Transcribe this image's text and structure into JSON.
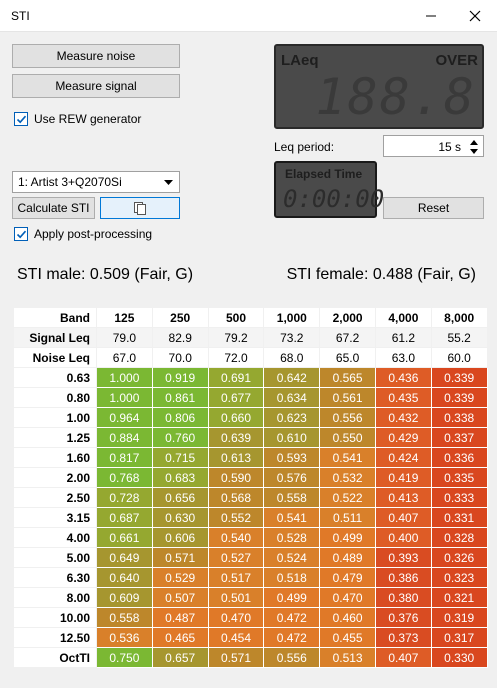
{
  "window": {
    "title": "STI"
  },
  "buttons": {
    "measure_noise": "Measure noise",
    "measure_signal": "Measure signal",
    "calculate_sti": "Calculate STI",
    "reset": "Reset"
  },
  "checkboxes": {
    "use_rew_generator": {
      "label": "Use REW generator",
      "checked": true
    },
    "apply_post_processing": {
      "label": "Apply post-processing",
      "checked": true
    }
  },
  "device_select": {
    "value": "1: Artist 3+Q2070Si"
  },
  "meter": {
    "label": "LAeq",
    "over": "OVER",
    "digits": "188.8"
  },
  "leq_period": {
    "label": "Leq period:",
    "value": "15 s"
  },
  "elapsed": {
    "label": "Elapsed Time",
    "value": "0:00:00"
  },
  "results": {
    "male": "STI male: 0.509 (Fair, G)",
    "female": "STI female: 0.488 (Fair, G)"
  },
  "table": {
    "bands": [
      "125",
      "250",
      "500",
      "1,000",
      "2,000",
      "4,000",
      "8,000"
    ],
    "header_label": "Band",
    "signal_label": "Signal Leq",
    "signal": [
      "79.0",
      "82.9",
      "79.2",
      "73.2",
      "67.2",
      "61.2",
      "55.2"
    ],
    "noise_label": "Noise Leq",
    "noise": [
      "67.0",
      "70.0",
      "72.0",
      "68.0",
      "65.0",
      "63.0",
      "60.0"
    ],
    "rows": [
      {
        "label": "0.63",
        "values": [
          "1.000",
          "0.919",
          "0.691",
          "0.642",
          "0.565",
          "0.436",
          "0.339"
        ]
      },
      {
        "label": "0.80",
        "values": [
          "1.000",
          "0.861",
          "0.677",
          "0.634",
          "0.561",
          "0.435",
          "0.339"
        ]
      },
      {
        "label": "1.00",
        "values": [
          "0.964",
          "0.806",
          "0.660",
          "0.623",
          "0.556",
          "0.432",
          "0.338"
        ]
      },
      {
        "label": "1.25",
        "values": [
          "0.884",
          "0.760",
          "0.639",
          "0.610",
          "0.550",
          "0.429",
          "0.337"
        ]
      },
      {
        "label": "1.60",
        "values": [
          "0.817",
          "0.715",
          "0.613",
          "0.593",
          "0.541",
          "0.424",
          "0.336"
        ]
      },
      {
        "label": "2.00",
        "values": [
          "0.768",
          "0.683",
          "0.590",
          "0.576",
          "0.532",
          "0.419",
          "0.335"
        ]
      },
      {
        "label": "2.50",
        "values": [
          "0.728",
          "0.656",
          "0.568",
          "0.558",
          "0.522",
          "0.413",
          "0.333"
        ]
      },
      {
        "label": "3.15",
        "values": [
          "0.687",
          "0.630",
          "0.552",
          "0.541",
          "0.511",
          "0.407",
          "0.331"
        ]
      },
      {
        "label": "4.00",
        "values": [
          "0.661",
          "0.606",
          "0.540",
          "0.528",
          "0.499",
          "0.400",
          "0.328"
        ]
      },
      {
        "label": "5.00",
        "values": [
          "0.649",
          "0.571",
          "0.527",
          "0.524",
          "0.489",
          "0.393",
          "0.326"
        ]
      },
      {
        "label": "6.30",
        "values": [
          "0.640",
          "0.529",
          "0.517",
          "0.518",
          "0.479",
          "0.386",
          "0.323"
        ]
      },
      {
        "label": "8.00",
        "values": [
          "0.609",
          "0.507",
          "0.501",
          "0.499",
          "0.470",
          "0.380",
          "0.321"
        ]
      },
      {
        "label": "10.00",
        "values": [
          "0.558",
          "0.487",
          "0.470",
          "0.472",
          "0.460",
          "0.376",
          "0.319"
        ]
      },
      {
        "label": "12.50",
        "values": [
          "0.536",
          "0.465",
          "0.454",
          "0.472",
          "0.455",
          "0.373",
          "0.317"
        ]
      },
      {
        "label": "OctTI",
        "values": [
          "0.750",
          "0.657",
          "0.571",
          "0.556",
          "0.513",
          "0.407",
          "0.330"
        ]
      }
    ]
  },
  "colors": {
    "excellent": "#7cb830",
    "good": "#8a9a2a",
    "fair": "#e07c2a",
    "poor": "#e05a2a",
    "bad": "#d9441f"
  }
}
